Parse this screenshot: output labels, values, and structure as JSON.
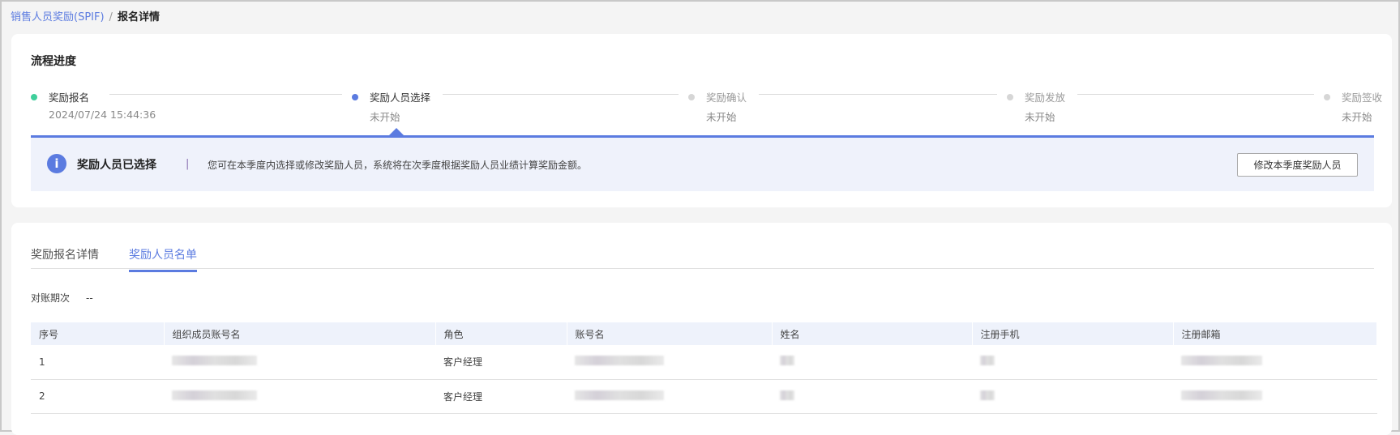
{
  "breadcrumb": {
    "parent": "销售人员奖励(SPIF)",
    "separator": "/",
    "current": "报名详情"
  },
  "progress": {
    "title": "流程进度",
    "steps": [
      {
        "label": "奖励报名",
        "sub": "2024/07/24 15:44:36",
        "status": "done"
      },
      {
        "label": "奖励人员选择",
        "sub": "未开始",
        "status": "current"
      },
      {
        "label": "奖励确认",
        "sub": "未开始",
        "status": "pending"
      },
      {
        "label": "奖励发放",
        "sub": "未开始",
        "status": "pending"
      },
      {
        "label": "奖励签收",
        "sub": "未开始",
        "status": "pending"
      }
    ]
  },
  "alert": {
    "title": "奖励人员已选择",
    "divider": "|",
    "text": "您可在本季度内选择或修改奖励人员，系统将在次季度根据奖励人员业绩计算奖励金额。",
    "button": "修改本季度奖励人员"
  },
  "tabs": [
    {
      "label": "奖励报名详情"
    },
    {
      "label": "奖励人员名单"
    }
  ],
  "record": {
    "label": "对账期次",
    "value": "--"
  },
  "table": {
    "headers": [
      "序号",
      "组织成员账号名",
      "角色",
      "账号名",
      "姓名",
      "注册手机",
      "注册邮箱"
    ],
    "rows": [
      {
        "index": "1",
        "role": "客户经理"
      },
      {
        "index": "2",
        "role": "客户经理"
      }
    ]
  },
  "colors": {
    "accent": "#5b7be0",
    "done": "#3fcf9b",
    "pending": "#d6d6d6"
  }
}
